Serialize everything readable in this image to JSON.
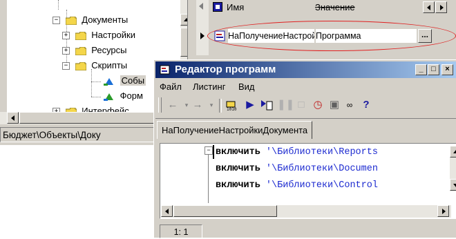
{
  "tree": {
    "items": [
      {
        "label": "Документы",
        "expander": "−"
      },
      {
        "label": "Настройки",
        "expander": "+"
      },
      {
        "label": "Ресурсы",
        "expander": "+"
      },
      {
        "label": "Скрипты",
        "expander": "−"
      },
      {
        "label": "Собы"
      },
      {
        "label": "Форм"
      },
      {
        "label": "Интерфейс",
        "expander": "+"
      }
    ],
    "path": "Бюджет\\Объекты\\Доку"
  },
  "grid": {
    "columns": [
      "Имя",
      "Значение"
    ],
    "row": {
      "name": "НаПолучениеНастройкиДокумента",
      "value": "Программа",
      "button": "..."
    }
  },
  "editor": {
    "title": "Редактор программ",
    "window_buttons": {
      "minimize": "_",
      "maximize": "□",
      "close": "×"
    },
    "menu": [
      "Файл",
      "Листинг",
      "Вид"
    ],
    "toolbar_icons": [
      "back-arrow-icon",
      "forward-arrow-icon",
      "compile-icon",
      "run-icon",
      "step-icon",
      "pause-icon",
      "stop-icon",
      "clock-icon",
      "save-icon",
      "find-icon",
      "help-icon"
    ],
    "help_label": "?",
    "tab": "НаПолучениеНастройкиДокумента",
    "code": [
      {
        "kw": "включить",
        "str": "'\\Библиотеки\\Reports"
      },
      {
        "kw": "включить",
        "str": "'\\Библиотеки\\Documen"
      },
      {
        "kw": "включить",
        "str": "'\\Библиотеки\\Control"
      }
    ],
    "status": "1: 1"
  },
  "colors": {
    "accent": "#0a246a",
    "highlight_ring": "#e02020",
    "code_string": "#1c2ad0"
  }
}
